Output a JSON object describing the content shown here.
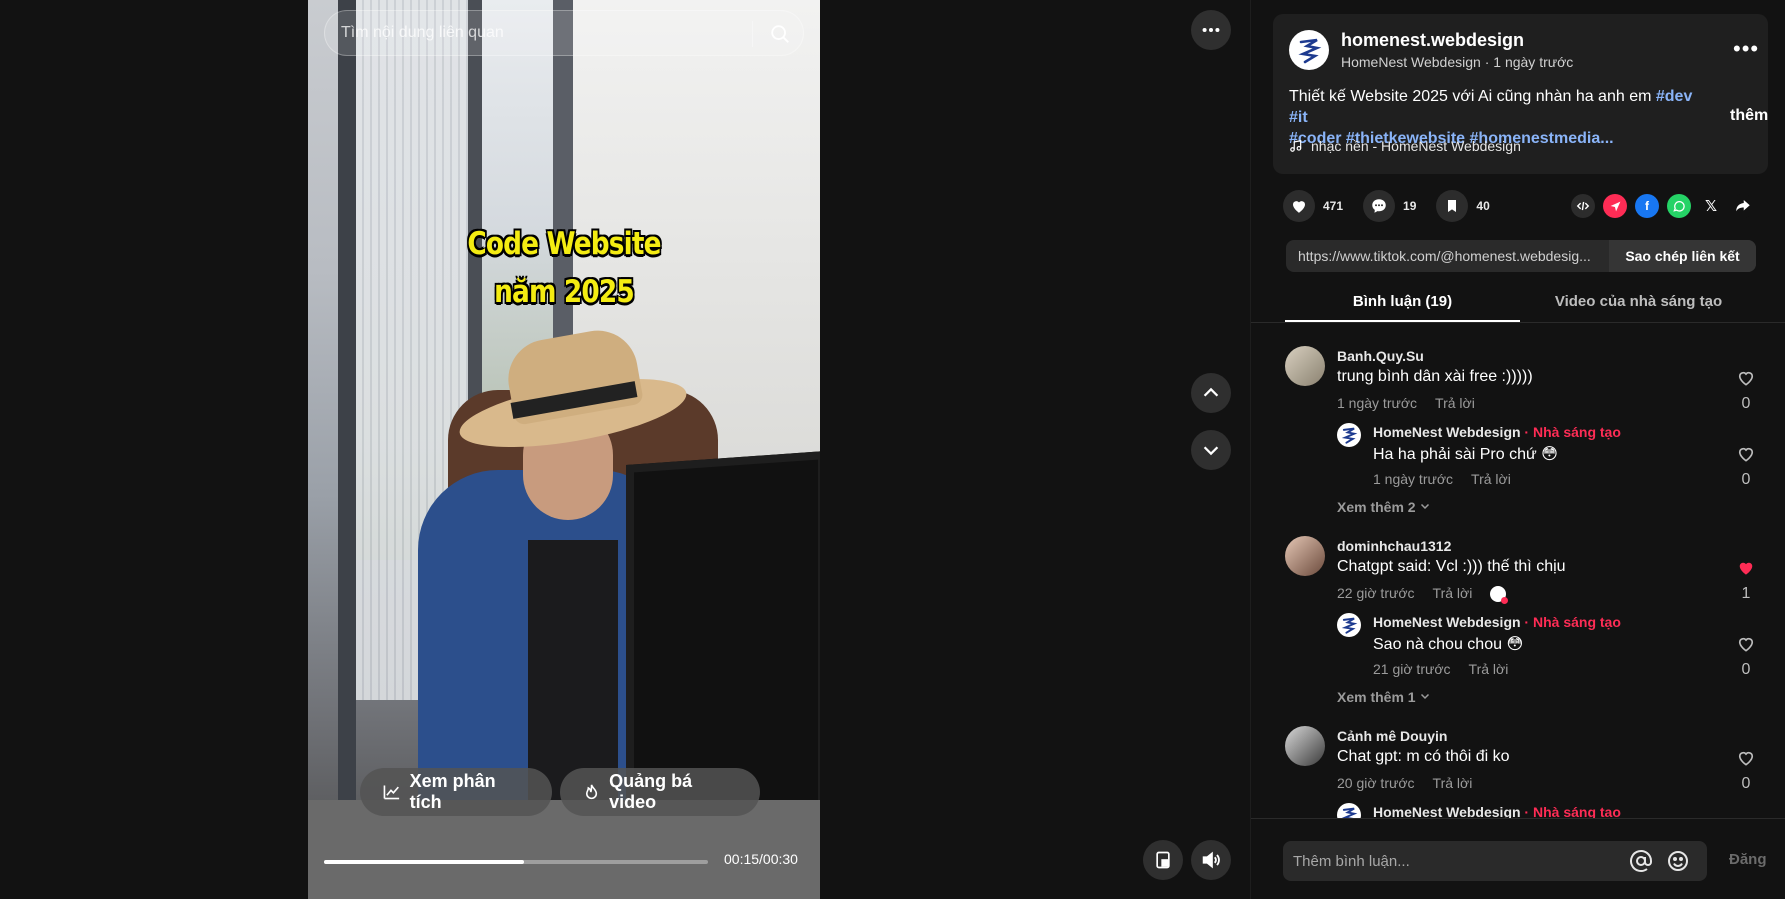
{
  "search": {
    "placeholder": "Tìm nội dung liên quan"
  },
  "video": {
    "overlay_line1": "Code Website",
    "overlay_line2": "năm 2025",
    "analytics_label": "Xem phân tích",
    "promote_label": "Quảng bá video",
    "time": "00:15/00:30",
    "progress": 0.52
  },
  "post": {
    "handle": "homenest.webdesign",
    "display_name": "HomeNest Webdesign",
    "posted": "1 ngày trước",
    "description": "Thiết kế Website 2025 với Ai cũng nhàn ha anh em",
    "tags": [
      "#dev",
      "#it",
      "#coder",
      "#thietkewebsite",
      "#homenestmedia..."
    ],
    "more": "thêm",
    "music": "nhạc nền - HomeNest Webdesign"
  },
  "stats": {
    "likes": "471",
    "comments": "19",
    "saves": "40"
  },
  "share": {
    "url": "https://www.tiktok.com/@homenest.webdesig...",
    "copy_label": "Sao chép liên kết",
    "icons": [
      "embed-icon",
      "send-icon",
      "facebook-icon",
      "whatsapp-icon",
      "x-icon",
      "share-icon"
    ],
    "colors": {
      "send": "#fe2c55",
      "facebook": "#1877f2",
      "whatsapp": "#25d366"
    }
  },
  "tabs": {
    "comments": "Bình luận (19)",
    "videos": "Video của nhà sáng tạo"
  },
  "comments": [
    {
      "name": "Banh.Quy.Su",
      "text": "trung bình dân xài free :)))))",
      "time": "1 ngày trước",
      "reply": "Trả lời",
      "likes": "0",
      "liked": false,
      "replies": [
        {
          "name": "HomeNest Webdesign",
          "badge": " · Nhà sáng tạo",
          "text": "Ha ha phải sài Pro chứ 😳",
          "time": "1 ngày trước",
          "reply": "Trả lời",
          "likes": "0"
        }
      ],
      "view_more": "Xem thêm 2"
    },
    {
      "name": "dominhchau1312",
      "text": "Chatgpt said: Vcl :))) thế thì chịu",
      "time": "22 giờ trước",
      "reply": "Trả lời",
      "likes": "1",
      "liked": true,
      "replies": [
        {
          "name": "HomeNest Webdesign",
          "badge": " · Nhà sáng tạo",
          "text": "Sao nà chou chou 😳",
          "time": "21 giờ trước",
          "reply": "Trả lời",
          "likes": "0"
        }
      ],
      "view_more": "Xem thêm 1"
    },
    {
      "name": "Cảnh mê Douyin",
      "text": "Chat gpt: m có thôi đi ko",
      "time": "20 giờ trước",
      "reply": "Trả lời",
      "likes": "0",
      "liked": false,
      "replies": [
        {
          "name": "HomeNest Webdesign",
          "badge": " · Nhà sáng tạo"
        }
      ]
    }
  ],
  "composer": {
    "placeholder": "Thêm bình luận...",
    "post_label": "Đăng"
  },
  "colors": {
    "accent": "#fe2c55",
    "hashtag": "#8ab4f8",
    "background": "#121212"
  }
}
